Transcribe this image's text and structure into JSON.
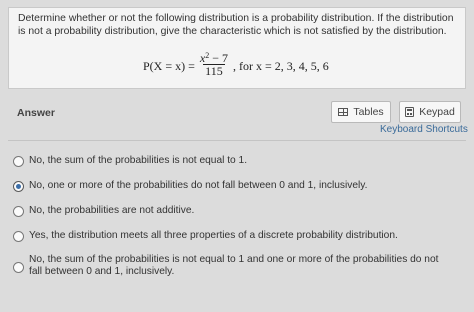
{
  "question": {
    "text": "Determine whether or not the following distribution is a probability distribution. If the distribution is not a probability distribution, give the characteristic which is not satisfied by the distribution.",
    "formula": {
      "lhs": "P(X = x) =",
      "numerator_base": "x",
      "numerator_exp": "2",
      "numerator_rest": " − 7",
      "denominator": "115",
      "rhs": ", for x = 2, 3, 4, 5, 6"
    }
  },
  "answer": {
    "label": "Answer",
    "tables_label": "Tables",
    "keypad_label": "Keypad",
    "shortcuts_label": "Keyboard Shortcuts"
  },
  "options": [
    {
      "text": "No, the sum of the probabilities is not equal to 1.",
      "selected": false
    },
    {
      "text": "No, one or more of the probabilities do not fall between 0 and 1, inclusively.",
      "selected": true
    },
    {
      "text": "No, the probabilities are not additive.",
      "selected": false
    },
    {
      "text": "Yes, the distribution meets all three properties of a discrete probability distribution.",
      "selected": false
    },
    {
      "text": "No, the sum of the probabilities is not equal to 1 and one or more of the probabilities do not fall between 0 and 1, inclusively.",
      "selected": false
    }
  ],
  "colors": {
    "accent": "#3b6ea8",
    "link": "#3a6b9a",
    "background": "#dcdcdc"
  }
}
